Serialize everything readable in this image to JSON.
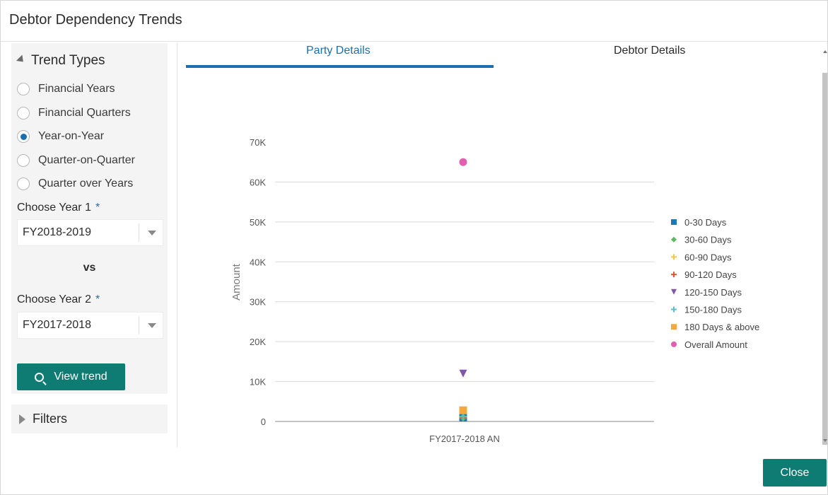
{
  "dialog": {
    "title": "Debtor Dependency Trends"
  },
  "sidebar": {
    "trend_types_label": "Trend Types",
    "options": [
      {
        "label": "Financial Years",
        "checked": false
      },
      {
        "label": "Financial Quarters",
        "checked": false
      },
      {
        "label": "Year-on-Year",
        "checked": true
      },
      {
        "label": "Quarter-on-Quarter",
        "checked": false
      },
      {
        "label": "Quarter over Years",
        "checked": false
      }
    ],
    "year1_label": "Choose Year 1",
    "year1_value": "FY2018-2019",
    "vs_label": "vs",
    "year2_label": "Choose Year 2",
    "year2_value": "FY2017-2018",
    "required_marker": "*",
    "view_trend_label": "View trend",
    "filters_label": "Filters"
  },
  "tabs": [
    {
      "label": "Party Details",
      "active": true
    },
    {
      "label": "Debtor Details",
      "active": false
    }
  ],
  "footer": {
    "close_label": "Close"
  },
  "colors": {
    "accent": "#1a6fb0",
    "primary_button": "#0e7c73"
  },
  "chart_data": {
    "type": "scatter",
    "ylabel": "Amount",
    "xlabel": "",
    "ylim": [
      0,
      70000
    ],
    "yticks": [
      0,
      10000,
      20000,
      30000,
      40000,
      50000,
      60000,
      70000
    ],
    "ytick_labels": [
      "0",
      "10K",
      "20K",
      "30K",
      "40K",
      "50K",
      "60K",
      "70K"
    ],
    "categories": [
      "FY2017-2018 AN"
    ],
    "legend_position": "right",
    "grid": true,
    "series": [
      {
        "name": "0-30 Days",
        "color": "#1f77b4",
        "marker": "square",
        "values": [
          1000
        ]
      },
      {
        "name": "30-60 Days",
        "color": "#5cb85c",
        "marker": "diamond",
        "values": [
          1000
        ]
      },
      {
        "name": "60-90 Days",
        "color": "#f2c94c",
        "marker": "plus",
        "values": [
          1000
        ]
      },
      {
        "name": "90-120 Days",
        "color": "#e2572d",
        "marker": "plus",
        "values": [
          1000
        ]
      },
      {
        "name": "120-150 Days",
        "color": "#7e57a8",
        "marker": "triangle-down",
        "values": [
          12000
        ]
      },
      {
        "name": "150-180 Days",
        "color": "#5bc0c6",
        "marker": "plus",
        "values": [
          1200
        ]
      },
      {
        "name": "180 Days & above",
        "color": "#f6a93b",
        "marker": "square",
        "values": [
          2800
        ]
      },
      {
        "name": "Overall Amount",
        "color": "#e05fb0",
        "marker": "circle",
        "values": [
          65000
        ]
      }
    ]
  }
}
